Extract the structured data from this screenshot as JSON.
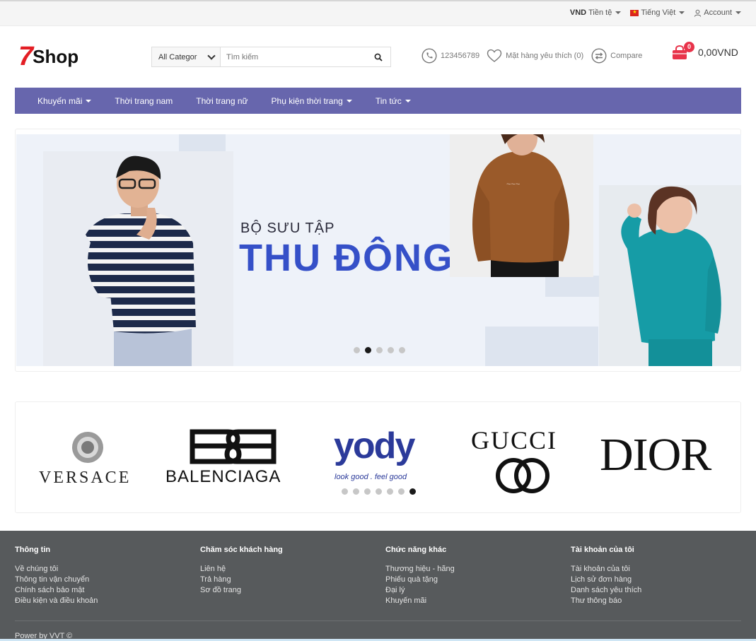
{
  "topbar": {
    "currency_code": "VND",
    "currency_label": "Tiền tệ",
    "language_label": "Tiếng Việt",
    "account_label": "Account"
  },
  "header": {
    "logo_number": "7",
    "logo_text": "Shop",
    "search_category": "All Categor",
    "search_placeholder": "Tìm kiếm",
    "phone": "123456789",
    "wishlist_label": "Mặt hàng yêu thích (0)",
    "compare_label": "Compare",
    "cart_count": "0",
    "cart_total": "0,00VND"
  },
  "nav": {
    "items": [
      {
        "label": "Khuyến mãi",
        "dropdown": true
      },
      {
        "label": "Thời trang nam",
        "dropdown": false
      },
      {
        "label": "Thời trang nữ",
        "dropdown": false
      },
      {
        "label": "Phụ kiện thời trang",
        "dropdown": true
      },
      {
        "label": "Tin tức",
        "dropdown": true
      }
    ]
  },
  "banner": {
    "subtitle": "BỘ SƯU TẬP",
    "title": "THU ĐÔNG",
    "slide_count": 5,
    "active_slide": 2
  },
  "brands": {
    "items": [
      "VERSACE",
      "BALENCIAGA",
      "yody",
      "look good . feel good",
      "GUCCI",
      "DIOR"
    ],
    "slide_count": 7,
    "active_slide": 7
  },
  "footer": {
    "columns": [
      {
        "title": "Thông tin",
        "links": [
          "Về chúng tôi",
          "Thông tin vận chuyển",
          "Chính sách bảo mật",
          "Điều kiện và điều khoản"
        ]
      },
      {
        "title": "Chăm sóc khách hàng",
        "links": [
          "Liên hệ",
          "Trả hàng",
          "Sơ đồ trang"
        ]
      },
      {
        "title": "Chức năng khác",
        "links": [
          "Thương hiệu - hãng",
          "Phiếu quà tặng",
          "Đại lý",
          "Khuyến mãi"
        ]
      },
      {
        "title": "Tài khoản của tôi",
        "links": [
          "Tài khoản của tôi",
          "Lịch sử đơn hàng",
          "Danh sách yêu thích",
          "Thư thông báo"
        ]
      }
    ],
    "power": "Power by VVT ©"
  },
  "colors": {
    "nav_bg": "#6766ad",
    "brand_red": "#e31e24",
    "banner_title": "#3550c8",
    "cart_badge": "#e8334a",
    "footer_bg": "#575a5c"
  },
  "icons": [
    "flag-vn-icon",
    "user-icon",
    "chevron-down-icon",
    "search-icon",
    "phone-icon",
    "heart-icon",
    "compare-icon",
    "cart-icon"
  ]
}
